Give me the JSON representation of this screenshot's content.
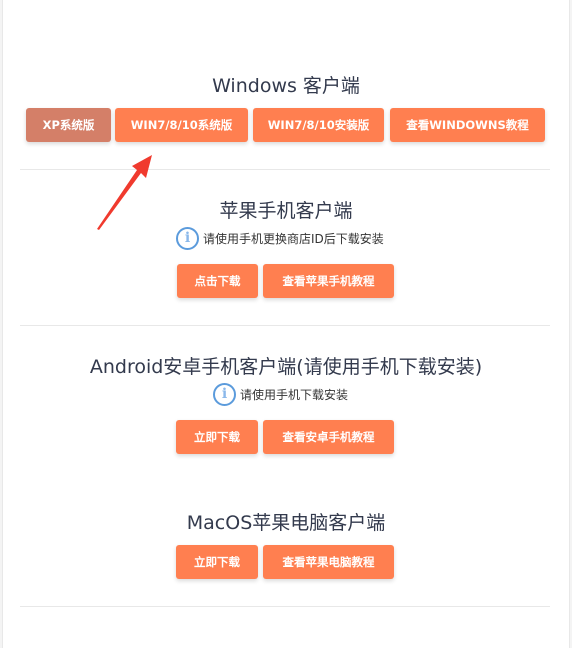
{
  "windows": {
    "title": "Windows 客户端",
    "buttons": [
      "XP系统版",
      "WIN7/8/10系统版",
      "WIN7/8/10安装版",
      "查看WINDOWNS教程"
    ]
  },
  "apple": {
    "title": "苹果手机客户端",
    "info": "请使用手机更换商店ID后下载安装",
    "buttons": [
      "点击下载",
      "查看苹果手机教程"
    ]
  },
  "android": {
    "title": "Android安卓手机客户端(请使用手机下载安装)",
    "info": "请使用手机下载安装",
    "buttons": [
      "立即下载",
      "查看安卓手机教程"
    ]
  },
  "mac": {
    "title": "MacOS苹果电脑客户端",
    "buttons": [
      "立即下载",
      "查看苹果电脑教程"
    ]
  },
  "colors": {
    "button": "#ff7f50",
    "selected_button": "#d47f68",
    "info_icon": "#5b9bdc",
    "arrow": "#f03a2e"
  }
}
